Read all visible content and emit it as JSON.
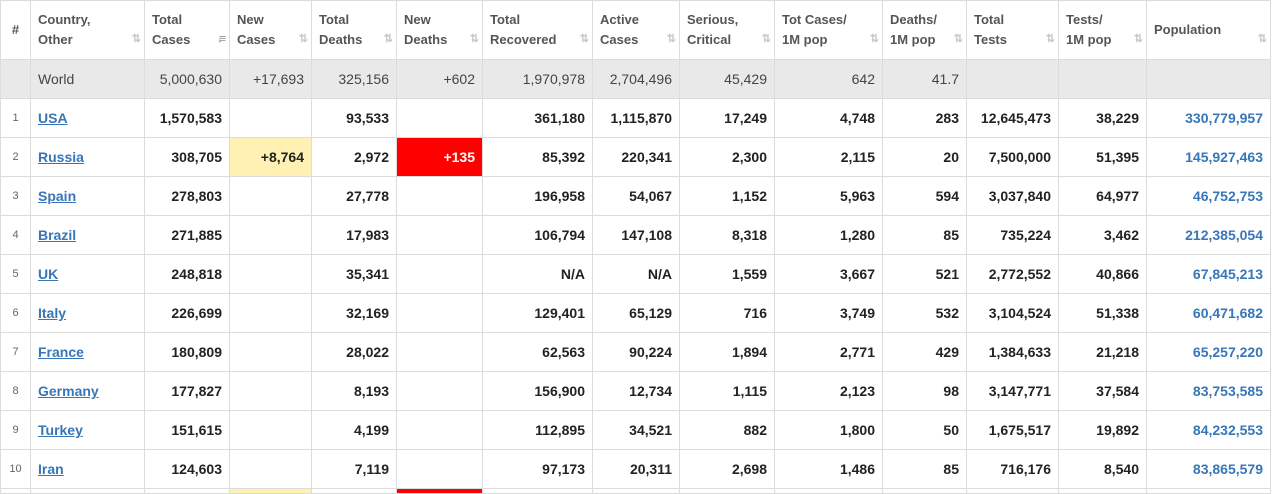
{
  "headers": {
    "idx": "#",
    "country": [
      "Country,",
      "Other"
    ],
    "total_cases": [
      "Total",
      "Cases"
    ],
    "new_cases": [
      "New",
      "Cases"
    ],
    "total_deaths": [
      "Total",
      "Deaths"
    ],
    "new_deaths": [
      "New",
      "Deaths"
    ],
    "total_recovered": [
      "Total",
      "Recovered"
    ],
    "active_cases": [
      "Active",
      "Cases"
    ],
    "serious_critical": [
      "Serious,",
      "Critical"
    ],
    "tot_cases_1m": [
      "Tot Cases/",
      "1M pop"
    ],
    "deaths_1m": [
      "Deaths/",
      "1M pop"
    ],
    "total_tests": [
      "Total",
      "Tests"
    ],
    "tests_1m": [
      "Tests/",
      "1M pop"
    ],
    "population": "Population"
  },
  "sort_icon": "⇅",
  "world": {
    "label": "World",
    "total_cases": "5,000,630",
    "new_cases": "+17,693",
    "total_deaths": "325,156",
    "new_deaths": "+602",
    "total_recovered": "1,970,978",
    "active_cases": "2,704,496",
    "serious_critical": "45,429",
    "tot_cases_1m": "642",
    "deaths_1m": "41.7",
    "total_tests": "",
    "tests_1m": "",
    "population": ""
  },
  "rows": [
    {
      "idx": "1",
      "country": "USA",
      "total_cases": "1,570,583",
      "new_cases": "",
      "total_deaths": "93,533",
      "new_deaths": "",
      "total_recovered": "361,180",
      "active_cases": "1,115,870",
      "serious_critical": "17,249",
      "tot_cases_1m": "4,748",
      "deaths_1m": "283",
      "total_tests": "12,645,473",
      "tests_1m": "38,229",
      "population": "330,779,957"
    },
    {
      "idx": "2",
      "country": "Russia",
      "total_cases": "308,705",
      "new_cases": "+8,764",
      "total_deaths": "2,972",
      "new_deaths": "+135",
      "total_recovered": "85,392",
      "active_cases": "220,341",
      "serious_critical": "2,300",
      "tot_cases_1m": "2,115",
      "deaths_1m": "20",
      "total_tests": "7,500,000",
      "tests_1m": "51,395",
      "population": "145,927,463"
    },
    {
      "idx": "3",
      "country": "Spain",
      "total_cases": "278,803",
      "new_cases": "",
      "total_deaths": "27,778",
      "new_deaths": "",
      "total_recovered": "196,958",
      "active_cases": "54,067",
      "serious_critical": "1,152",
      "tot_cases_1m": "5,963",
      "deaths_1m": "594",
      "total_tests": "3,037,840",
      "tests_1m": "64,977",
      "population": "46,752,753"
    },
    {
      "idx": "4",
      "country": "Brazil",
      "total_cases": "271,885",
      "new_cases": "",
      "total_deaths": "17,983",
      "new_deaths": "",
      "total_recovered": "106,794",
      "active_cases": "147,108",
      "serious_critical": "8,318",
      "tot_cases_1m": "1,280",
      "deaths_1m": "85",
      "total_tests": "735,224",
      "tests_1m": "3,462",
      "population": "212,385,054"
    },
    {
      "idx": "5",
      "country": "UK",
      "total_cases": "248,818",
      "new_cases": "",
      "total_deaths": "35,341",
      "new_deaths": "",
      "total_recovered": "N/A",
      "active_cases": "N/A",
      "serious_critical": "1,559",
      "tot_cases_1m": "3,667",
      "deaths_1m": "521",
      "total_tests": "2,772,552",
      "tests_1m": "40,866",
      "population": "67,845,213"
    },
    {
      "idx": "6",
      "country": "Italy",
      "total_cases": "226,699",
      "new_cases": "",
      "total_deaths": "32,169",
      "new_deaths": "",
      "total_recovered": "129,401",
      "active_cases": "65,129",
      "serious_critical": "716",
      "tot_cases_1m": "3,749",
      "deaths_1m": "532",
      "total_tests": "3,104,524",
      "tests_1m": "51,338",
      "population": "60,471,682"
    },
    {
      "idx": "7",
      "country": "France",
      "total_cases": "180,809",
      "new_cases": "",
      "total_deaths": "28,022",
      "new_deaths": "",
      "total_recovered": "62,563",
      "active_cases": "90,224",
      "serious_critical": "1,894",
      "tot_cases_1m": "2,771",
      "deaths_1m": "429",
      "total_tests": "1,384,633",
      "tests_1m": "21,218",
      "population": "65,257,220"
    },
    {
      "idx": "8",
      "country": "Germany",
      "total_cases": "177,827",
      "new_cases": "",
      "total_deaths": "8,193",
      "new_deaths": "",
      "total_recovered": "156,900",
      "active_cases": "12,734",
      "serious_critical": "1,115",
      "tot_cases_1m": "2,123",
      "deaths_1m": "98",
      "total_tests": "3,147,771",
      "tests_1m": "37,584",
      "population": "83,753,585"
    },
    {
      "idx": "9",
      "country": "Turkey",
      "total_cases": "151,615",
      "new_cases": "",
      "total_deaths": "4,199",
      "new_deaths": "",
      "total_recovered": "112,895",
      "active_cases": "34,521",
      "serious_critical": "882",
      "tot_cases_1m": "1,800",
      "deaths_1m": "50",
      "total_tests": "1,675,517",
      "tests_1m": "19,892",
      "population": "84,232,553"
    },
    {
      "idx": "10",
      "country": "Iran",
      "total_cases": "124,603",
      "new_cases": "",
      "total_deaths": "7,119",
      "new_deaths": "",
      "total_recovered": "97,173",
      "active_cases": "20,311",
      "serious_critical": "2,698",
      "tot_cases_1m": "1,486",
      "deaths_1m": "85",
      "total_tests": "716,176",
      "tests_1m": "8,540",
      "population": "83,865,579"
    }
  ],
  "colors": {
    "link": "#3776b8",
    "new_cases_highlight": "#fff0b3",
    "new_deaths_highlight": "#ff0000",
    "world_row_bg": "#e9e9e9"
  }
}
